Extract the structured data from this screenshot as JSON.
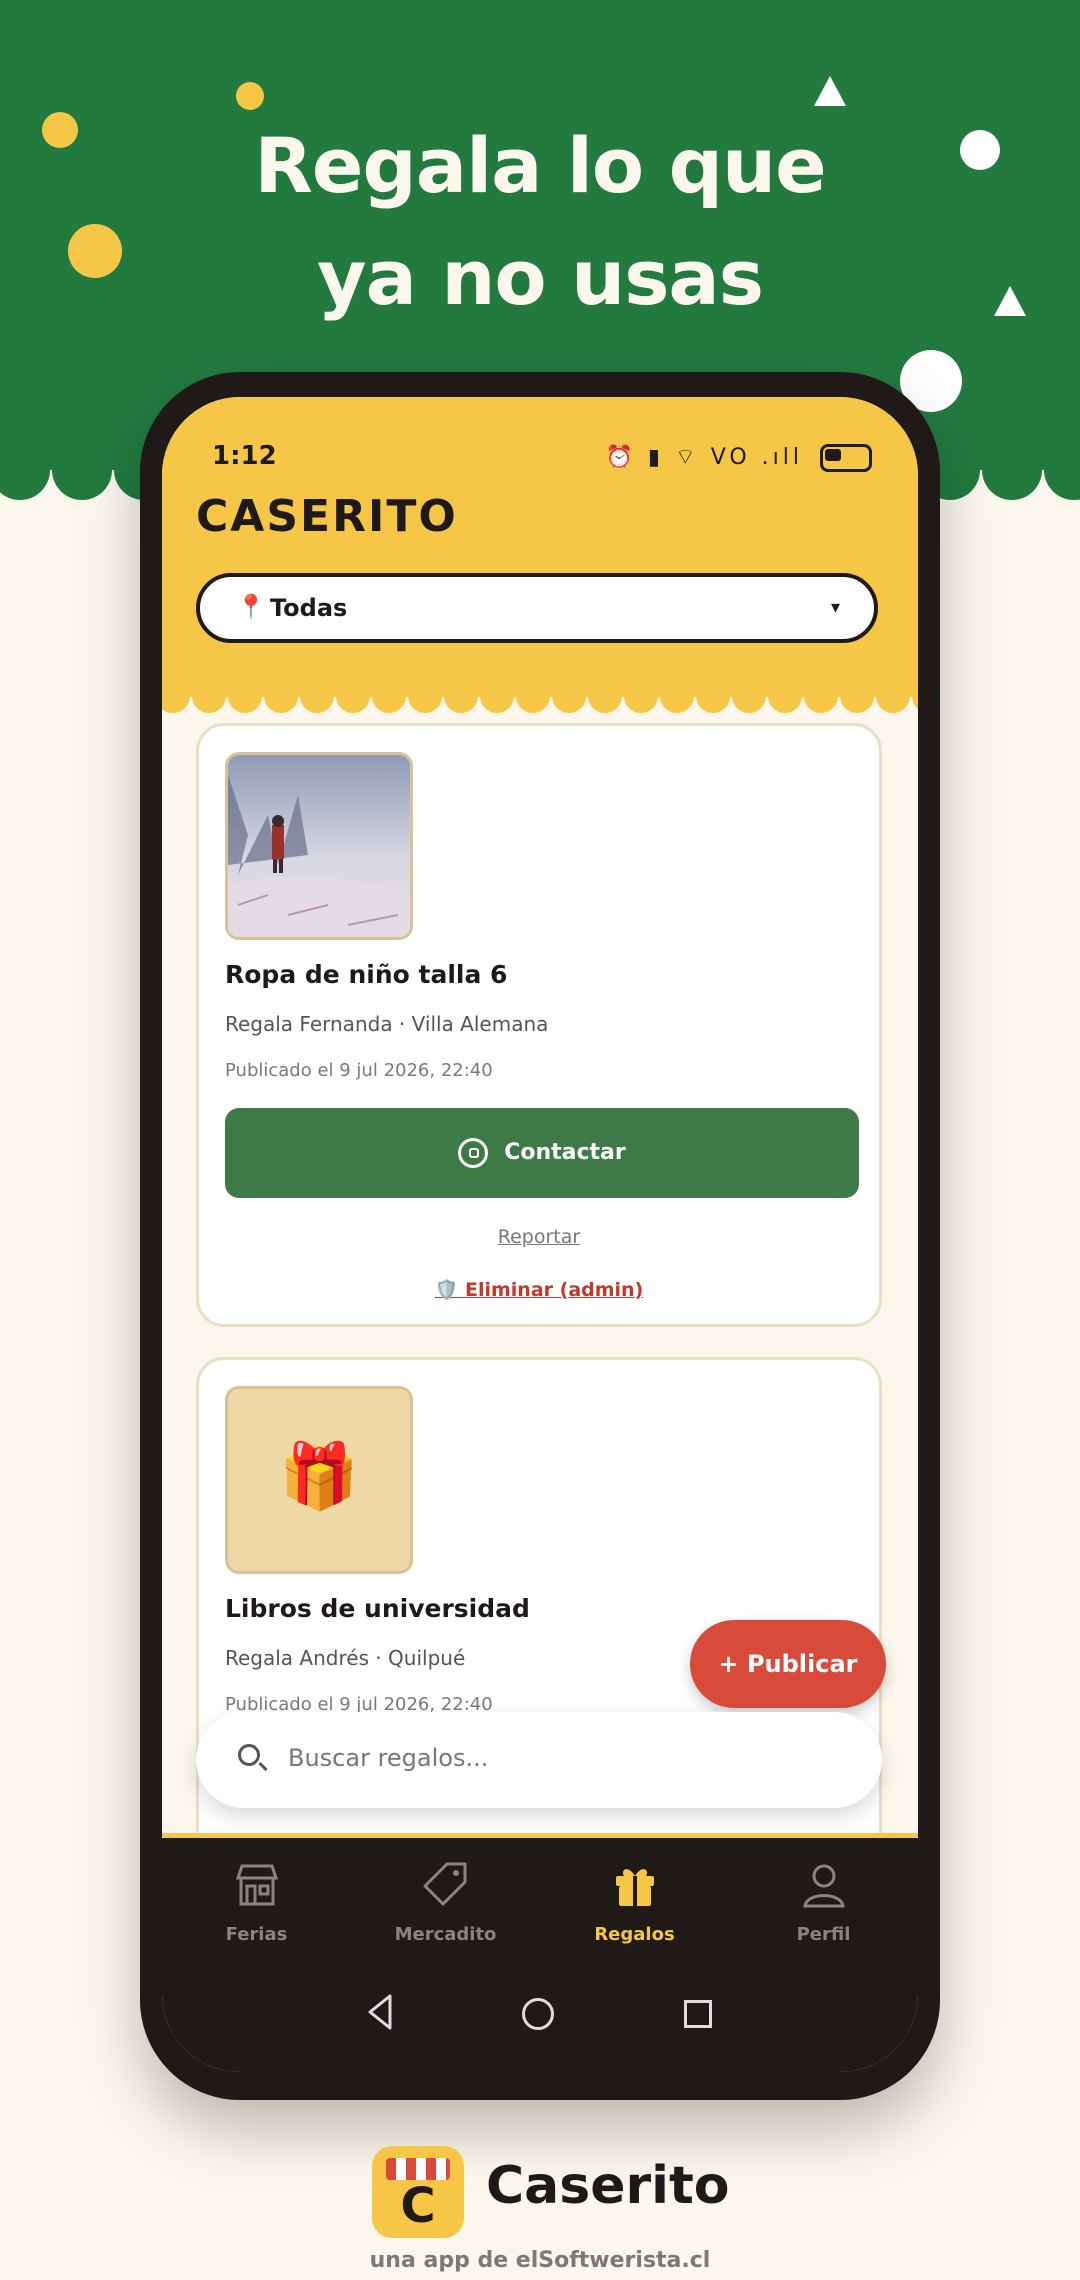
{
  "banner": {
    "headline_line1": "Regala lo que",
    "headline_line2": "ya no usas"
  },
  "status": {
    "time": "1:12",
    "icons": "⏰ ▮ ⌔ VO .ıll"
  },
  "app": {
    "name": "CASERITO",
    "location_filter": {
      "selected": "Todas",
      "pin_icon": "pin-icon",
      "caret": "▾"
    }
  },
  "listings": [
    {
      "title": "Ropa de niño talla 6",
      "meta": "Regala Fernanda · Villa Alemana",
      "date": "Publicado el 9 jul 2026, 22:40",
      "contact_label": "Contactar",
      "report_label": "Reportar",
      "admin_label": "🛡️ Eliminar (admin)"
    },
    {
      "title": "Libros de universidad",
      "meta": "Regala Andrés · Quilpué",
      "date": "Publicado el 9 jul 2026, 22:40",
      "placeholder_icon": "🎁"
    }
  ],
  "fab": {
    "label": "+ Publicar"
  },
  "search": {
    "placeholder": "Buscar regalos..."
  },
  "nav": [
    {
      "label": "Ferias",
      "icon": "store-icon"
    },
    {
      "label": "Mercadito",
      "icon": "tag-icon"
    },
    {
      "label": "Regalos",
      "icon": "gift-icon",
      "active": true
    },
    {
      "label": "Perfil",
      "icon": "user-icon"
    }
  ],
  "footer": {
    "logo_letter": "C",
    "brand": "Caserito",
    "tagline": "una app de elSoftwerista.cl"
  },
  "colors": {
    "banner_green": "#237a3f",
    "header_yellow": "#f6c646",
    "contact_green": "#3e7a47",
    "fab_red": "#d84a3a",
    "nav_dark": "#1f1a17"
  }
}
